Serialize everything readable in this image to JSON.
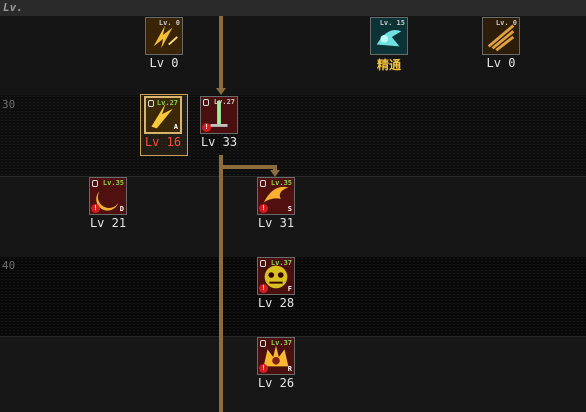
{
  "header": "Lv.",
  "level_markers": [
    "30",
    "40"
  ],
  "colors": {
    "line": "#8c6b3c",
    "selected_border": "#d8b56a",
    "level_text": "#e6e6e6",
    "level_text_warning": "#ff4a3a",
    "mastery_text": "#f0c040",
    "req_ok": "#8ad04a"
  },
  "skills": [
    {
      "icon": "lightning-strike-icon",
      "req": "Lv. 0",
      "level": "Lv 0"
    },
    {
      "icon": "ice-burst-icon",
      "req": "Lv. 15",
      "level": "精通"
    },
    {
      "icon": "claw-slash-icon",
      "req": "Lv. 0",
      "level": "Lv 0"
    },
    {
      "icon": "lightning-slash-icon",
      "req": "Lv.27",
      "grade": "A",
      "level": "Lv 16",
      "selected": true
    },
    {
      "icon": "sword-thrust-icon",
      "req": "Lv.27",
      "warn": "!",
      "level": "Lv 33"
    },
    {
      "icon": "crescent-moon-icon",
      "req": "Lv.35",
      "warn": "!",
      "grade": "D",
      "level": "Lv 21"
    },
    {
      "icon": "flame-swipe-icon",
      "req": "Lv.35",
      "warn": "!",
      "grade": "S",
      "level": "Lv 31"
    },
    {
      "icon": "demon-face-icon",
      "req": "Lv.37",
      "warn": "!",
      "grade": "F",
      "level": "Lv 28"
    },
    {
      "icon": "fire-beast-icon",
      "req": "Lv.37",
      "warn": "!",
      "grade": "R",
      "level": "Lv 26"
    }
  ]
}
